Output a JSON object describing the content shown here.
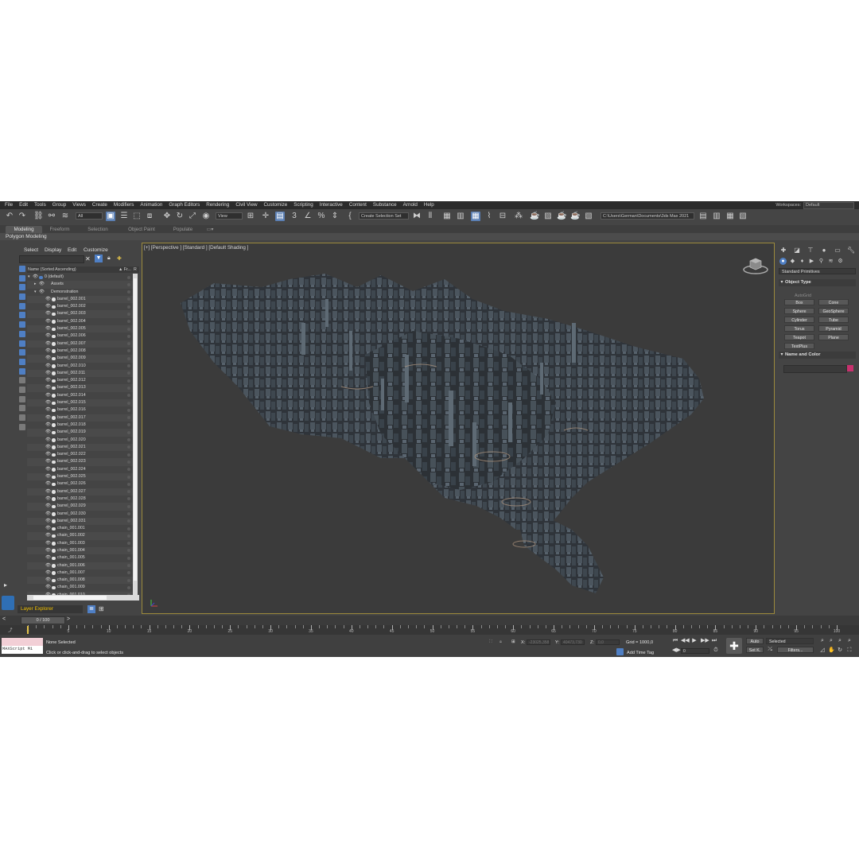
{
  "menu": {
    "items": [
      "File",
      "Edit",
      "Tools",
      "Group",
      "Views",
      "Create",
      "Modifiers",
      "Animation",
      "Graph Editors",
      "Rendering",
      "Civil View",
      "Customize",
      "Scripting",
      "Interactive",
      "Content",
      "Substance",
      "Arnold",
      "Help"
    ],
    "workspaces_label": "Workspaces:",
    "workspaces_value": "Default"
  },
  "toolbar": {
    "selection_filter": "All",
    "reference_coord": "View",
    "selection_set_placeholder": "Create Selection Set",
    "project_path": "C:\\Users\\German\\Documents\\3ds Max 2021"
  },
  "ribbon": {
    "tabs": [
      "Modeling",
      "Freeform",
      "Selection",
      "Object Paint",
      "Populate"
    ],
    "active_panel": "Polygon Modeling"
  },
  "explorer": {
    "menu": [
      "Select",
      "Display",
      "Edit",
      "Customize"
    ],
    "column_name": "Name (Sorted Ascending)",
    "column_frozen": "▲ Fr...",
    "column_render": "R",
    "layer_root": "0 (default)",
    "groups": [
      "Assets",
      "Demonstration"
    ],
    "objects": [
      "barrel_002.001",
      "barrel_002.002",
      "barrel_002.003",
      "barrel_002.004",
      "barrel_002.005",
      "barrel_002.006",
      "barrel_002.007",
      "barrel_002.008",
      "barrel_002.009",
      "barrel_002.010",
      "barrel_002.011",
      "barrel_002.012",
      "barrel_002.013",
      "barrel_002.014",
      "barrel_002.015",
      "barrel_002.016",
      "barrel_002.017",
      "barrel_002.018",
      "barrel_002.019",
      "barrel_002.020",
      "barrel_002.021",
      "barrel_002.022",
      "barrel_002.023",
      "barrel_002.024",
      "barrel_002.025",
      "barrel_002.026",
      "barrel_002.027",
      "barrel_002.028",
      "barrel_002.029",
      "barrel_002.030",
      "barrel_002.031",
      "chain_001.001",
      "chain_001.002",
      "chain_001.003",
      "chain_001.004",
      "chain_001.005",
      "chain_001.006",
      "chain_001.007",
      "chain_001.008",
      "chain_001.009",
      "chain_001.010"
    ],
    "layer_explorer_label": "Layer Explorer"
  },
  "viewport": {
    "label": "[+] [Perspective ] [Standard ] [Default Shading ]"
  },
  "command_panel": {
    "category": "Standard Primitives",
    "object_type_title": "Object Type",
    "autogrid_label": "AutoGrid",
    "primitives": [
      "Box",
      "Cone",
      "Sphere",
      "GeoSphere",
      "Cylinder",
      "Tube",
      "Torus",
      "Pyramid",
      "Teapot",
      "Plane",
      "TextPlus"
    ],
    "name_color_title": "Name and Color",
    "object_color": "#c8316e"
  },
  "timeline": {
    "frame_counter": "0 / 100",
    "current_frame": 0,
    "total_frames": 100,
    "tick_labels": [
      "0",
      "5",
      "10",
      "15",
      "20",
      "25",
      "30",
      "35",
      "40",
      "45",
      "50",
      "55",
      "60",
      "65",
      "70",
      "75",
      "80",
      "85",
      "90",
      "95",
      "100"
    ]
  },
  "status": {
    "maxscript_label": "MAXScript Mi",
    "selection_status": "None Selected",
    "prompt": "Click or click-and-drag to select objects",
    "x_label": "X:",
    "x_value": "-23025,358",
    "y_label": "Y:",
    "y_value": "40473,730",
    "z_label": "Z:",
    "z_value": "0,0",
    "grid": "Grid = 1000,0",
    "add_time_tag": "Add Time Tag",
    "auto_label": "Auto",
    "set_key_label": "Set K.",
    "key_filter_value": "Selected",
    "filters_label": "Filters...",
    "frame_field": "0"
  }
}
